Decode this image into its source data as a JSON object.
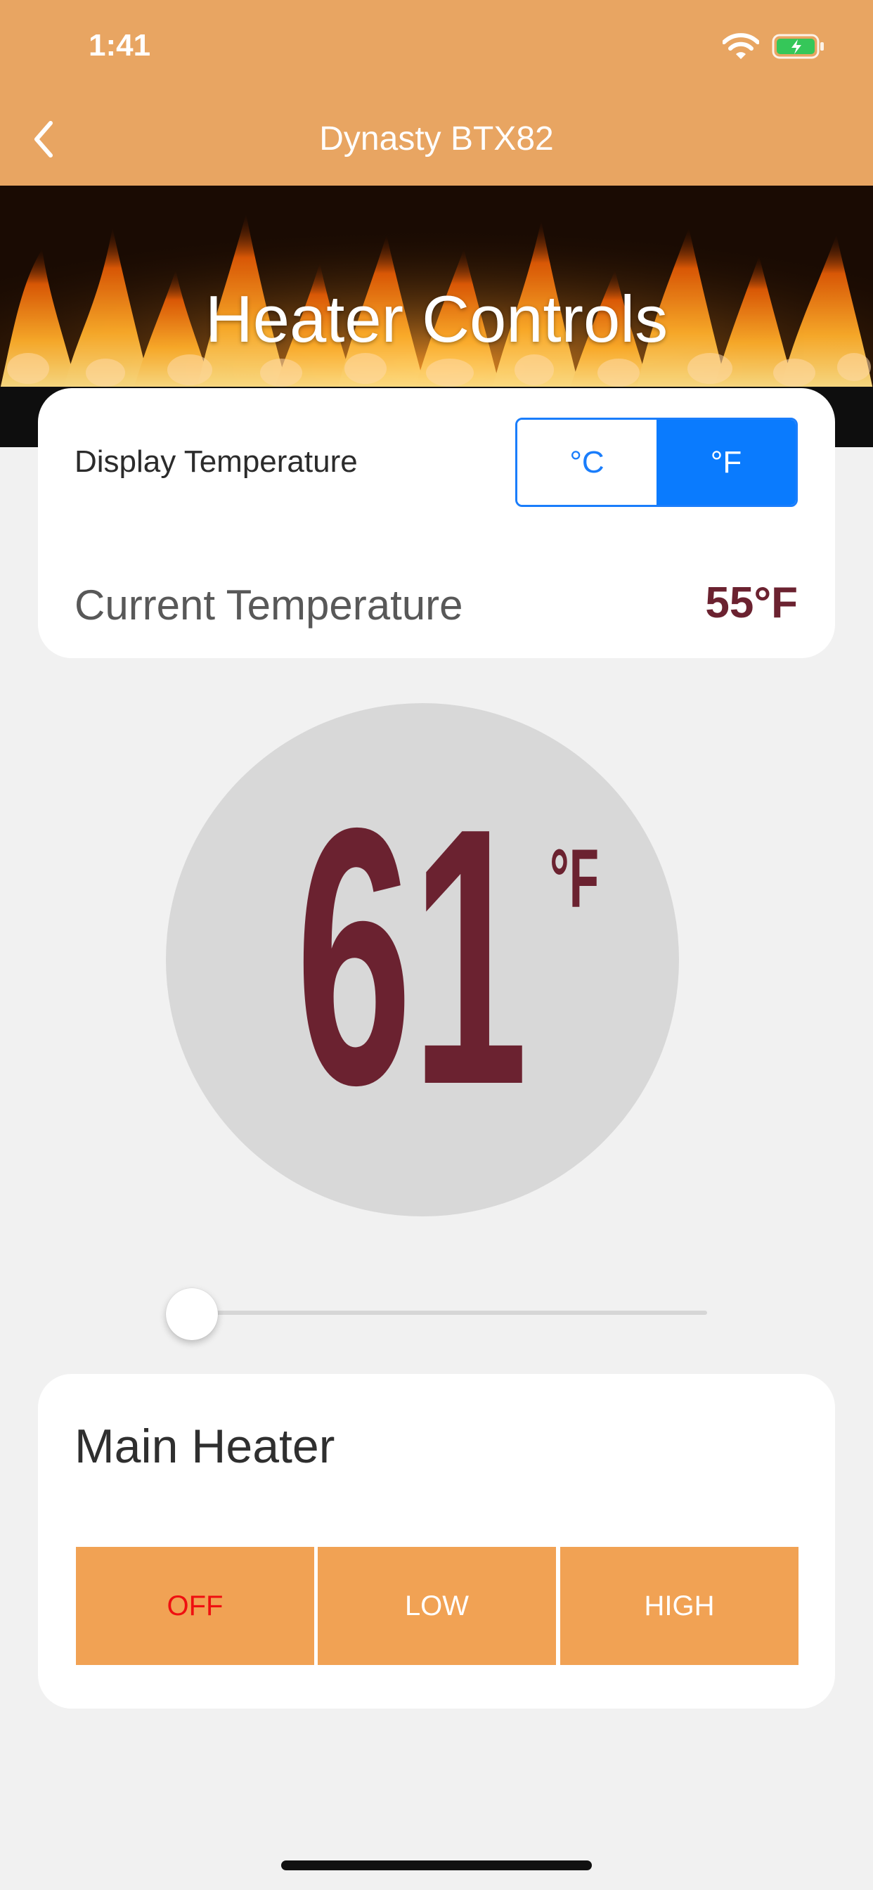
{
  "status_bar": {
    "time": "1:41"
  },
  "nav": {
    "title": "Dynasty BTX82",
    "back_icon": "chevron-left-icon"
  },
  "banner": {
    "title": "Heater Controls"
  },
  "temperature": {
    "display_label": "Display Temperature",
    "units": [
      "°C",
      "°F"
    ],
    "selected_unit": "°F",
    "current_label": "Current Temperature",
    "current_value": "55°F"
  },
  "setpoint": {
    "value": "61",
    "unit": "°F",
    "slider_position": 0
  },
  "heater": {
    "title": "Main Heater",
    "modes": [
      "OFF",
      "LOW",
      "HIGH"
    ],
    "active_mode": "OFF"
  },
  "colors": {
    "header": "#e8a562",
    "accent_blue": "#0a7bfe",
    "temp_text": "#6b2230",
    "button": "#f1a254",
    "active_mode_text": "#ef0f10"
  }
}
